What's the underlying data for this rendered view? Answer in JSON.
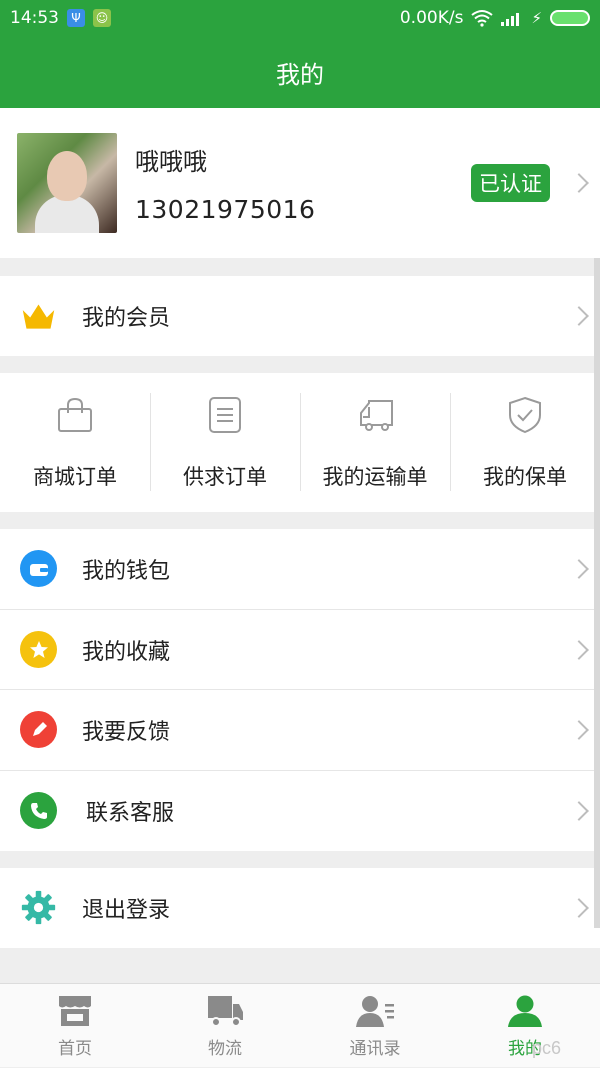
{
  "status_bar": {
    "time": "14:53",
    "network_speed": "0.00K/s",
    "icons": [
      "usb-icon",
      "android-icon",
      "wifi-icon",
      "signal-icon",
      "charging-icon",
      "battery-icon"
    ]
  },
  "header": {
    "title": "我的"
  },
  "profile": {
    "name": "哦哦哦",
    "phone": "13021975016",
    "verified_label": "已认证"
  },
  "membership": {
    "label": "我的会员",
    "icon": "crown-icon"
  },
  "orders": [
    {
      "label": "商城订单",
      "icon": "shopping-bag-icon"
    },
    {
      "label": "供求订单",
      "icon": "document-list-icon"
    },
    {
      "label": "我的运输单",
      "icon": "truck-icon"
    },
    {
      "label": "我的保单",
      "icon": "shield-check-icon"
    }
  ],
  "menu": [
    {
      "label": "我的钱包",
      "icon": "wallet-icon",
      "color": "#2196f3"
    },
    {
      "label": "我的收藏",
      "icon": "star-icon",
      "color": "#f5c20e"
    },
    {
      "label": "我要反馈",
      "icon": "pencil-icon",
      "color": "#ef4136"
    },
    {
      "label": "联系客服",
      "icon": "phone-icon",
      "color": "#2ba33e"
    }
  ],
  "logout": {
    "label": "退出登录",
    "icon": "gear-icon",
    "color": "#35b9a6"
  },
  "tabs": [
    {
      "label": "首页",
      "icon": "store-icon"
    },
    {
      "label": "物流",
      "icon": "truck-icon"
    },
    {
      "label": "通讯录",
      "icon": "contacts-icon"
    },
    {
      "label": "我的",
      "icon": "user-icon",
      "active": true
    }
  ],
  "colors": {
    "brand": "#2ba33e",
    "background": "#eeeeee",
    "inactive_tab": "#8a8a8a"
  },
  "watermark": "pc6"
}
